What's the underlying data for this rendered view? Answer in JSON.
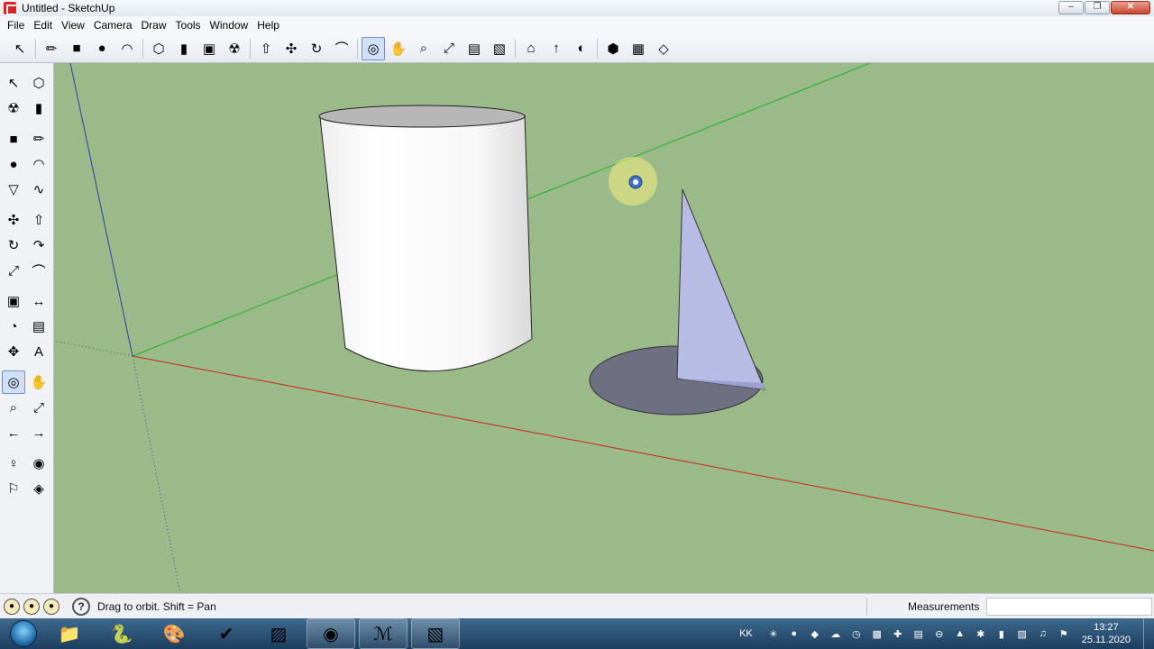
{
  "window": {
    "title": "Untitled - SketchUp",
    "minimize": "–",
    "restore": "❐",
    "close": "✕"
  },
  "menu": [
    "File",
    "Edit",
    "View",
    "Camera",
    "Draw",
    "Tools",
    "Window",
    "Help"
  ],
  "toolbar_top": [
    {
      "name": "select-tool-icon",
      "glyph": "↖"
    },
    {
      "name": "line-tool-icon",
      "glyph": "✏"
    },
    {
      "name": "rectangle-tool-icon",
      "glyph": "■"
    },
    {
      "name": "circle-tool-icon",
      "glyph": "●"
    },
    {
      "name": "arc-tool-icon",
      "glyph": "◠"
    },
    {
      "name": "make-component-icon",
      "glyph": "⬡"
    },
    {
      "name": "eraser-tool-icon",
      "glyph": "▮"
    },
    {
      "name": "tape-measure-icon",
      "glyph": "▣"
    },
    {
      "name": "paint-bucket-icon",
      "glyph": "☢"
    },
    {
      "name": "push-pull-icon",
      "glyph": "⇧"
    },
    {
      "name": "move-tool-icon",
      "glyph": "✣"
    },
    {
      "name": "rotate-tool-icon",
      "glyph": "↻"
    },
    {
      "name": "offset-tool-icon",
      "glyph": "⌒"
    },
    {
      "name": "orbit-tool-icon",
      "glyph": "◎"
    },
    {
      "name": "pan-tool-icon",
      "glyph": "✋"
    },
    {
      "name": "zoom-tool-icon",
      "glyph": "⌕"
    },
    {
      "name": "zoom-extents-icon",
      "glyph": "⤢"
    },
    {
      "name": "previous-view-icon",
      "glyph": "▤"
    },
    {
      "name": "next-view-icon",
      "glyph": "▧"
    },
    {
      "name": "get-models-icon",
      "glyph": "⌂"
    },
    {
      "name": "share-model-icon",
      "glyph": "↑"
    },
    {
      "name": "google-earth-icon",
      "glyph": "◐"
    },
    {
      "name": "components-icon",
      "glyph": "⬢"
    },
    {
      "name": "extension-warehouse-icon",
      "glyph": "▦"
    },
    {
      "name": "layout-icon",
      "glyph": "◇"
    }
  ],
  "toolbar_left": [
    [
      {
        "name": "select-icon",
        "glyph": "↖"
      },
      {
        "name": "make-component-icon",
        "glyph": "⬡"
      }
    ],
    [
      {
        "name": "paint-bucket-icon",
        "glyph": "☢"
      },
      {
        "name": "eraser-icon",
        "glyph": "▮"
      }
    ],
    [
      {
        "name": "rectangle-icon",
        "glyph": "■"
      },
      {
        "name": "line-icon",
        "glyph": "✏"
      }
    ],
    [
      {
        "name": "circle-icon",
        "glyph": "●"
      },
      {
        "name": "arc-icon",
        "glyph": "◠"
      }
    ],
    [
      {
        "name": "polygon-icon",
        "glyph": "▽"
      },
      {
        "name": "freehand-icon",
        "glyph": "∿"
      }
    ],
    [
      {
        "name": "move-icon",
        "glyph": "✣"
      },
      {
        "name": "push-pull-icon",
        "glyph": "⇧"
      }
    ],
    [
      {
        "name": "rotate-icon",
        "glyph": "↻"
      },
      {
        "name": "follow-me-icon",
        "glyph": "↷"
      }
    ],
    [
      {
        "name": "scale-icon",
        "glyph": "⤢"
      },
      {
        "name": "offset-icon",
        "glyph": "⌒"
      }
    ],
    [
      {
        "name": "tape-measure-icon",
        "glyph": "▣"
      },
      {
        "name": "dimension-icon",
        "glyph": "↔"
      }
    ],
    [
      {
        "name": "protractor-icon",
        "glyph": "◔"
      },
      {
        "name": "text-icon",
        "glyph": "▤"
      }
    ],
    [
      {
        "name": "axes-icon",
        "glyph": "✥"
      },
      {
        "name": "3d-text-icon",
        "glyph": "A"
      }
    ],
    [
      {
        "name": "orbit-icon",
        "glyph": "◎"
      },
      {
        "name": "pan-icon",
        "glyph": "✋"
      }
    ],
    [
      {
        "name": "zoom-icon",
        "glyph": "⌕"
      },
      {
        "name": "zoom-window-icon",
        "glyph": "⤢"
      }
    ],
    [
      {
        "name": "previous-icon",
        "glyph": "←"
      },
      {
        "name": "next-icon",
        "glyph": "→"
      }
    ],
    [
      {
        "name": "position-camera-icon",
        "glyph": "♀"
      },
      {
        "name": "look-around-icon",
        "glyph": "◉"
      }
    ],
    [
      {
        "name": "walk-icon",
        "glyph": "⚐"
      },
      {
        "name": "section-plane-icon",
        "glyph": "◈"
      }
    ]
  ],
  "status": {
    "hint": "Drag to orbit.  Shift = Pan",
    "help": "?",
    "measurements_label": "Measurements",
    "measurements_value": ""
  },
  "taskbar": {
    "items": [
      {
        "name": "windows-explorer-icon",
        "glyph": "📁"
      },
      {
        "name": "python-icon",
        "glyph": "🐍"
      },
      {
        "name": "paint-icon",
        "glyph": "🎨"
      },
      {
        "name": "app-green-icon",
        "glyph": "✔"
      },
      {
        "name": "screen-capture-icon",
        "glyph": "▨"
      },
      {
        "name": "chrome-icon",
        "glyph": "◉"
      },
      {
        "name": "acrobat-icon",
        "glyph": "ℳ"
      },
      {
        "name": "sketchup-icon",
        "glyph": "▧"
      }
    ],
    "language": "KK",
    "time": "13:27",
    "date": "25.11.2020"
  }
}
